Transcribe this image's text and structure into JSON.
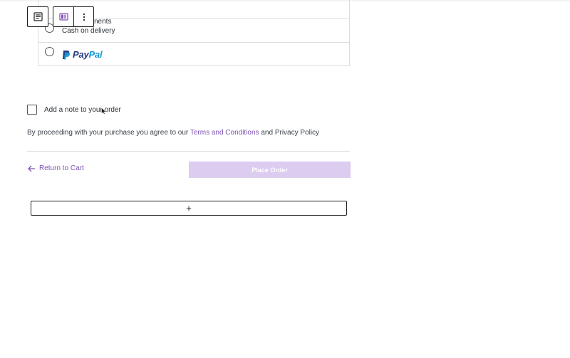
{
  "payment": {
    "partial_label": "nents",
    "options": [
      {
        "label": "Cash on delivery"
      },
      {
        "label": "PayPal"
      }
    ],
    "paypal_pay": "Pay",
    "paypal_pal": "Pal"
  },
  "note": {
    "label": "Add a note to your order"
  },
  "terms": {
    "prefix": "By proceeding with your purchase you agree to our ",
    "terms_link": "Terms and Conditions",
    "and": " and ",
    "privacy": "Privacy Policy"
  },
  "actions": {
    "return_label": "Return to Cart",
    "place_order_label": "Place Order"
  },
  "add_block": {
    "symbol": "+"
  },
  "colors": {
    "accent": "#7f54b3",
    "place_order_bg": "#dcccf0",
    "paypal_dark": "#253b80",
    "paypal_light": "#179bd7"
  }
}
